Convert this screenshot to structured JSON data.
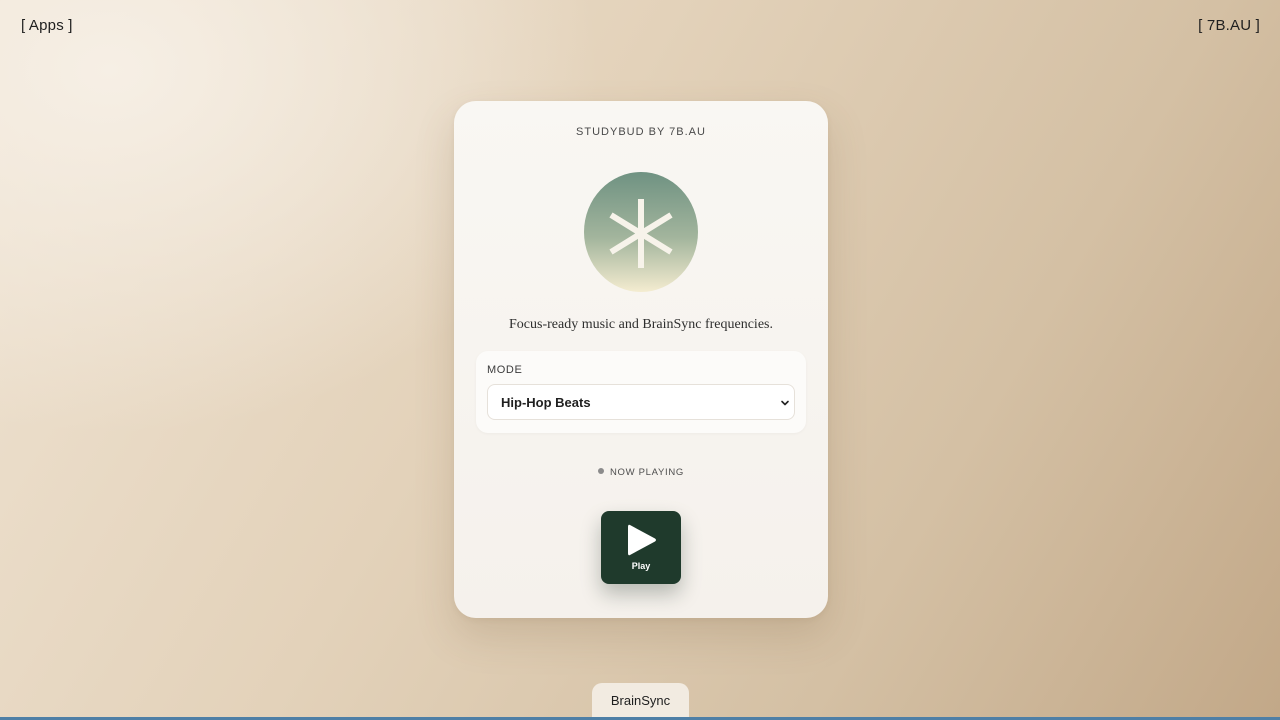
{
  "nav": {
    "left_link": "[ Apps ]",
    "right_link": "[ 7B.AU ]"
  },
  "card": {
    "brand": "STUDYBUD BY 7B.AU",
    "emblem_icon": "asterisk-icon",
    "tagline": "Focus-ready music and BrainSync frequencies.",
    "mode": {
      "label": "MODE",
      "selected": "Hip-Hop Beats"
    },
    "status": "NOW PLAYING",
    "play": {
      "label": "Play",
      "icon": "play-icon"
    }
  },
  "bottom_tab": {
    "label": "BrainSync"
  },
  "colors": {
    "play_button": "#1f3a2c",
    "emblem_top": "#6f9282",
    "emblem_bottom": "#f4ecd0",
    "bottom_bar": "#4e7fa6"
  }
}
